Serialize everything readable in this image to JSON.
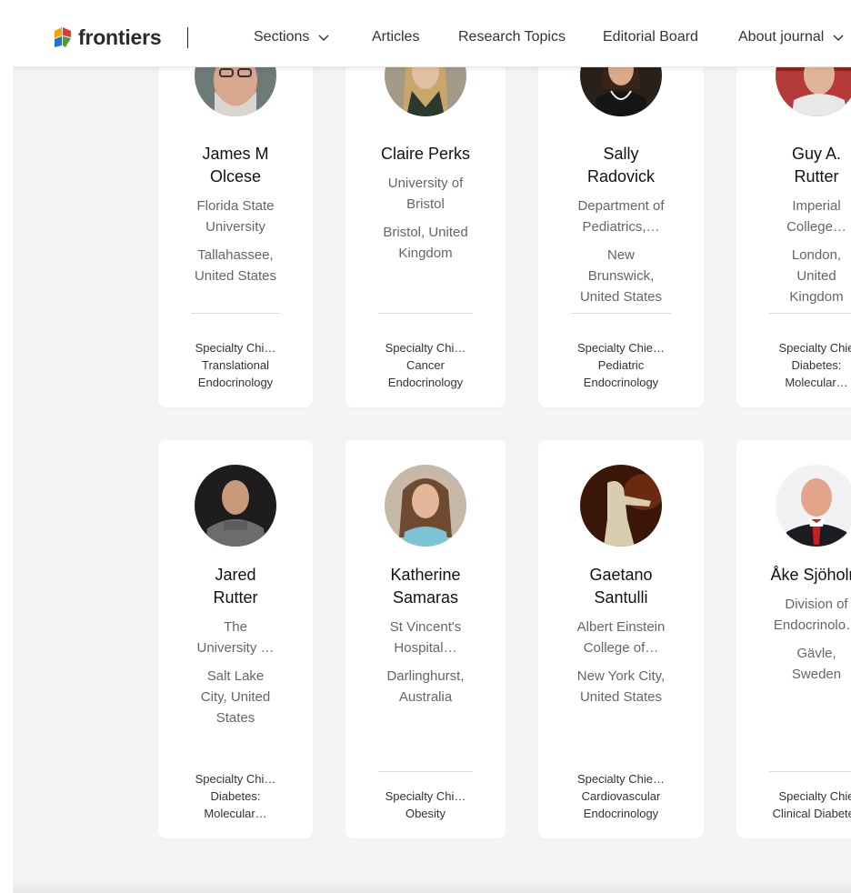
{
  "header": {
    "logo_text": "frontiers",
    "nav": [
      {
        "label": "Sections",
        "has_dropdown": true
      },
      {
        "label": "Articles",
        "has_dropdown": false
      },
      {
        "label": "Research Topics",
        "has_dropdown": false
      },
      {
        "label": "Editorial Board",
        "has_dropdown": false
      },
      {
        "label": "About journal",
        "has_dropdown": true
      }
    ]
  },
  "editors": [
    {
      "name_lines": [
        "James M",
        "Olcese"
      ],
      "institution_lines": [
        "Florida State",
        "University"
      ],
      "location_lines": [
        "Tallahassee,",
        "United States"
      ],
      "role_lines": [
        "Specialty Chi…",
        "Translational",
        "Endocrinology"
      ]
    },
    {
      "name_lines": [
        "Claire Perks"
      ],
      "institution_lines": [
        "University of",
        "Bristol"
      ],
      "location_lines": [
        "Bristol, United",
        "Kingdom"
      ],
      "role_lines": [
        "Specialty Chi…",
        "Cancer",
        "Endocrinology"
      ]
    },
    {
      "name_lines": [
        "Sally",
        "Radovick"
      ],
      "institution_lines": [
        "Department of",
        "Pediatrics,…"
      ],
      "location_lines": [
        "New",
        "Brunswick,",
        "United States"
      ],
      "role_lines": [
        "Specialty Chie…",
        "Pediatric",
        "Endocrinology"
      ]
    },
    {
      "name_lines": [
        "Guy A.",
        "Rutter"
      ],
      "institution_lines": [
        "Imperial",
        "College…"
      ],
      "location_lines": [
        "London,",
        "United",
        "Kingdom"
      ],
      "role_lines": [
        "Specialty Chie",
        "Diabetes:",
        "Molecular…"
      ]
    },
    {
      "name_lines": [
        "Jared",
        "Rutter"
      ],
      "institution_lines": [
        "The",
        "University …"
      ],
      "location_lines": [
        "Salt Lake",
        "City, United",
        "States"
      ],
      "role_lines": [
        "Specialty Chi…",
        "Diabetes:",
        "Molecular…"
      ]
    },
    {
      "name_lines": [
        "Katherine",
        "Samaras"
      ],
      "institution_lines": [
        "St Vincent's",
        "Hospital…"
      ],
      "location_lines": [
        "Darlinghurst,",
        "Australia"
      ],
      "role_lines": [
        "Specialty Chi…",
        "Obesity"
      ]
    },
    {
      "name_lines": [
        "Gaetano",
        "Santulli"
      ],
      "institution_lines": [
        "Albert Einstein",
        "College of…"
      ],
      "location_lines": [
        "New York City,",
        "United States"
      ],
      "role_lines": [
        "Specialty Chie…",
        "Cardiovascular",
        "Endocrinology"
      ]
    },
    {
      "name_lines": [
        "Åke Sjöholm"
      ],
      "institution_lines": [
        "Division of",
        "Endocrinolo…"
      ],
      "location_lines": [
        "Gävle,",
        "Sweden"
      ],
      "role_lines": [
        "Specialty Chie",
        "Clinical Diabetes"
      ]
    }
  ],
  "colors": {
    "background": "#f4f4f4",
    "card": "#ffffff",
    "text_primary": "#111111",
    "text_secondary": "#666666"
  }
}
